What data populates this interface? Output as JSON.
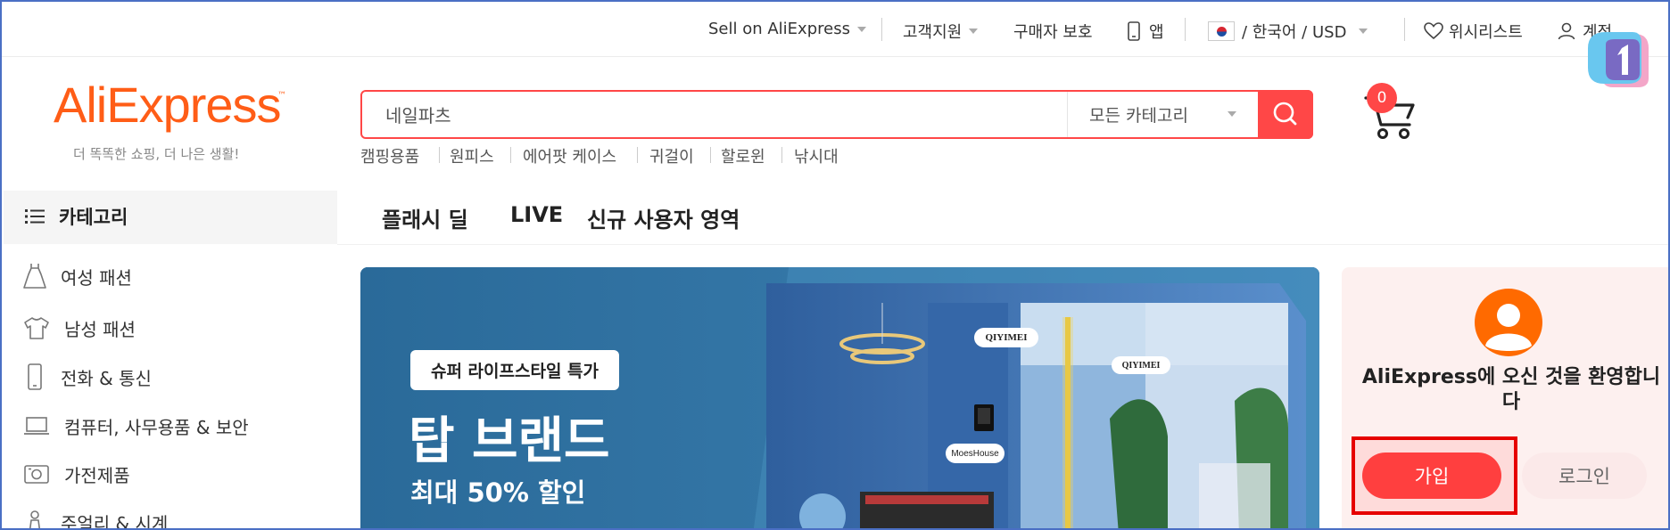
{
  "colors": {
    "brand_orange": "#ff5d17",
    "accent_red": "#ff4747",
    "banner_blue": "#2e6e9e",
    "welcome_bg": "#fdf0ef"
  },
  "topbar": {
    "sell": "Sell on AliExpress",
    "support": "고객지원",
    "buyer_protection": "구매자 보호",
    "app": "앱",
    "language_currency": "/ 한국어 /  USD",
    "wishlist": "위시리스트",
    "account": "계정"
  },
  "logo": {
    "text": "AliExpress",
    "tm": "™",
    "tagline": "더 똑똑한 쇼핑, 더 나은 생활!"
  },
  "search": {
    "value": "네일파츠",
    "category": "모든 카테고리",
    "hot_keywords": [
      "캠핑용품",
      "원피스",
      "에어팟 케이스",
      "귀걸이",
      "할로윈",
      "낚시대"
    ]
  },
  "cart": {
    "count": "0"
  },
  "sidebar": {
    "title": "카테고리",
    "items": [
      {
        "label": "여성 패션",
        "icon": "dress-icon"
      },
      {
        "label": "남성 패션",
        "icon": "shirt-icon"
      },
      {
        "label": "전화 & 통신",
        "icon": "phone-icon"
      },
      {
        "label": "컴퓨터, 사무용품 & 보안",
        "icon": "laptop-icon"
      },
      {
        "label": "가전제품",
        "icon": "appliance-icon"
      },
      {
        "label": "주얼리 & 시계",
        "icon": "jewelry-icon"
      }
    ]
  },
  "nav": {
    "items": [
      "플래시 딜",
      "LIVE",
      "신규 사용자 영역"
    ]
  },
  "banner": {
    "tag": "슈퍼 라이프스타일 특가",
    "title": "탑 브랜드",
    "subtitle": "최대 50% 할인",
    "brand_labels": [
      "QIYIMEI",
      "QIYIMEI",
      "MoesHouse"
    ]
  },
  "welcome": {
    "text": "AliExpress에 오신 것을 환영합니다",
    "join": "가입",
    "login": "로그인"
  }
}
